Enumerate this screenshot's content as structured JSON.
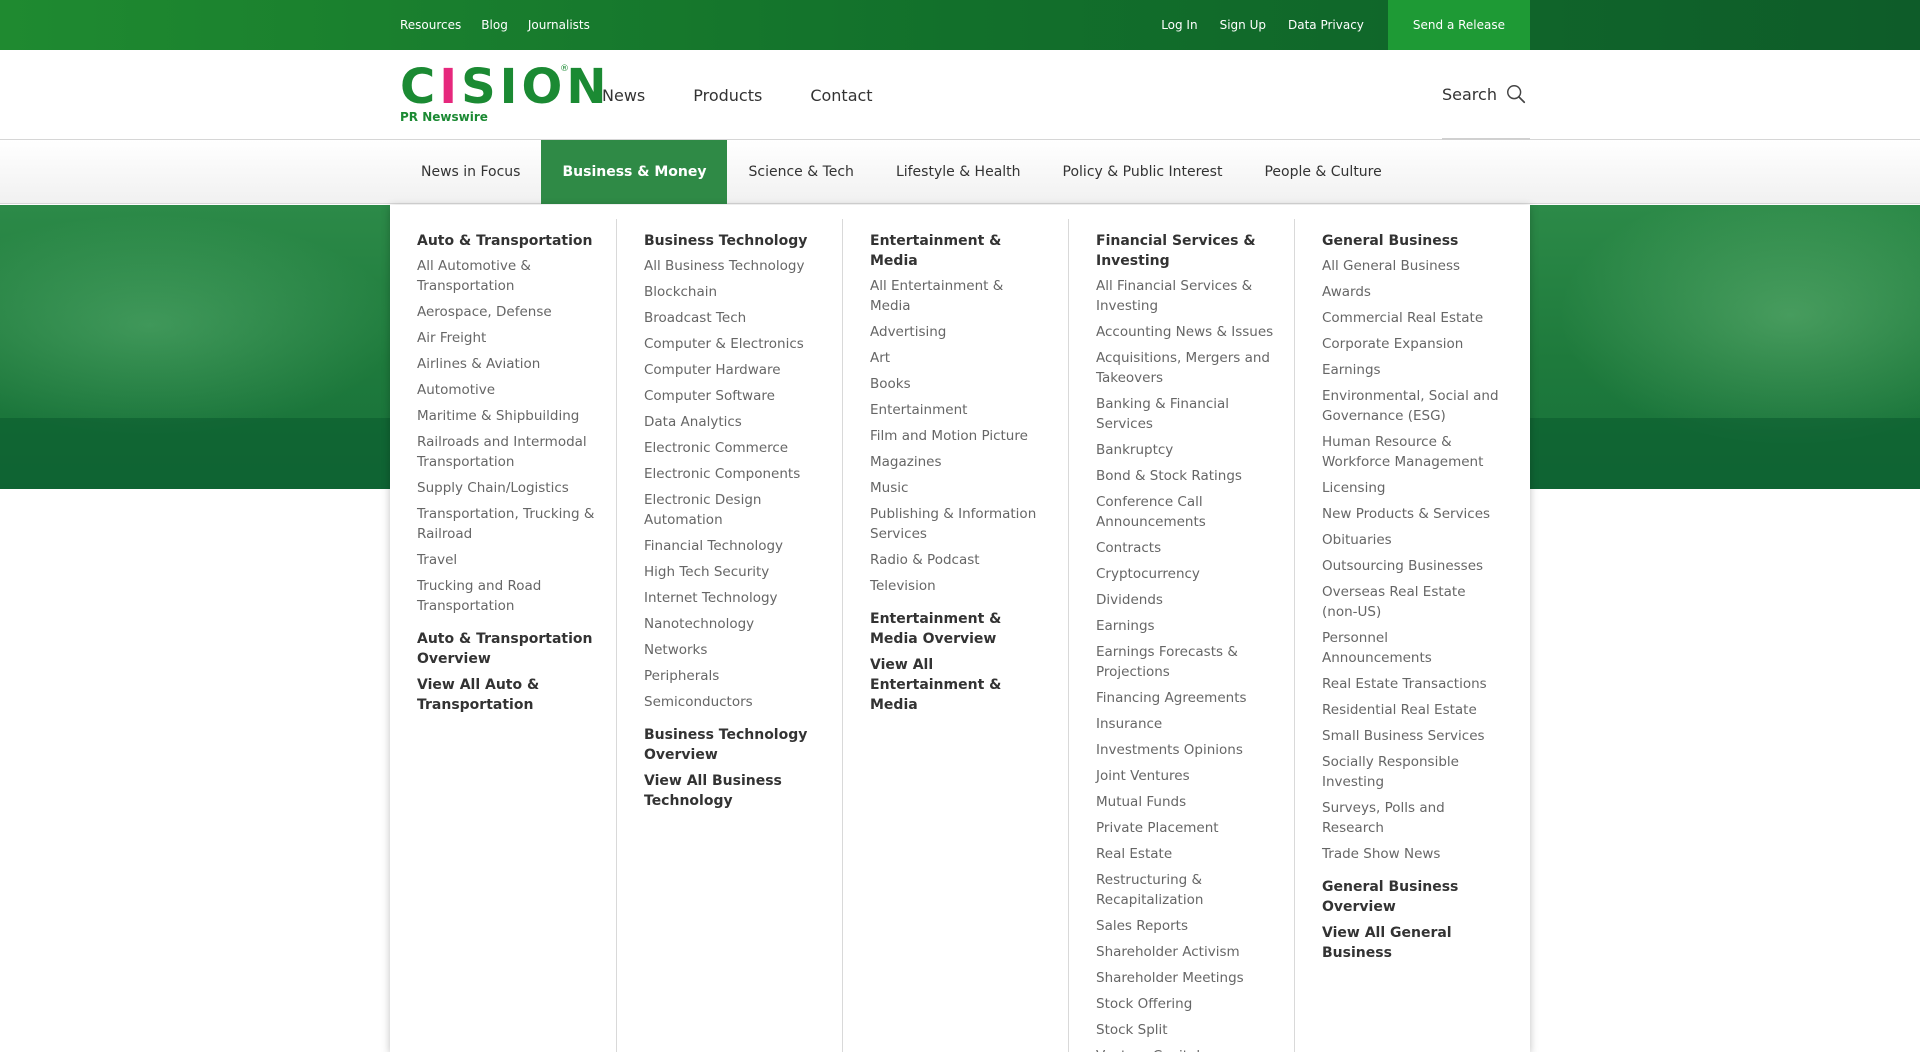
{
  "topbar": {
    "left_links": [
      "Resources",
      "Blog",
      "Journalists"
    ],
    "right_links": [
      "Log In",
      "Sign Up",
      "Data Privacy"
    ],
    "cta": "Send a Release"
  },
  "header": {
    "logo_text": "CISION",
    "logo_reg": "®",
    "logo_sub": "PR Newswire",
    "nav": [
      "News",
      "Products",
      "Contact"
    ],
    "search_label": "Search"
  },
  "categories": {
    "items": [
      "News in Focus",
      "Business & Money",
      "Science & Tech",
      "Lifestyle & Health",
      "Policy & Public Interest",
      "People & Culture"
    ],
    "active": "Business & Money"
  },
  "colors": {
    "brand_green": "#1b8a33",
    "brand_pink": "#e6287d",
    "active_tab": "#2f8a46"
  },
  "mega": {
    "columns": [
      {
        "title": "Auto & Transportation",
        "items": [
          "All Automotive & Transportation",
          "Aerospace, Defense",
          "Air Freight",
          "Airlines & Aviation",
          "Automotive",
          "Maritime & Shipbuilding",
          "Railroads and Intermodal Transportation",
          "Supply Chain/Logistics",
          "Transportation, Trucking & Railroad",
          "Travel",
          "Trucking and Road Transportation"
        ],
        "overview": "Auto & Transportation Overview",
        "view_all": "View All Auto & Transportation"
      },
      {
        "title": "Business Technology",
        "items": [
          "All Business Technology",
          "Blockchain",
          "Broadcast Tech",
          "Computer & Electronics",
          "Computer Hardware",
          "Computer Software",
          "Data Analytics",
          "Electronic Commerce",
          "Electronic Components",
          "Electronic Design Automation",
          "Financial Technology",
          "High Tech Security",
          "Internet Technology",
          "Nanotechnology",
          "Networks",
          "Peripherals",
          "Semiconductors"
        ],
        "overview": "Business Technology Overview",
        "view_all": "View All Business Technology"
      },
      {
        "title": "Entertainment & Media",
        "items": [
          "All Entertainment & Media",
          "Advertising",
          "Art",
          "Books",
          "Entertainment",
          "Film and Motion Picture",
          "Magazines",
          "Music",
          "Publishing & Information Services",
          "Radio & Podcast",
          "Television"
        ],
        "overview": "Entertainment & Media Overview",
        "view_all": "View All Entertainment & Media"
      },
      {
        "title": "Financial Services & Investing",
        "items": [
          "All Financial Services & Investing",
          "Accounting News & Issues",
          "Acquisitions, Mergers and Takeovers",
          "Banking & Financial Services",
          "Bankruptcy",
          "Bond & Stock Ratings",
          "Conference Call Announcements",
          "Contracts",
          "Cryptocurrency",
          "Dividends",
          "Earnings",
          "Earnings Forecasts & Projections",
          "Financing Agreements",
          "Insurance",
          "Investments Opinions",
          "Joint Ventures",
          "Mutual Funds",
          "Private Placement",
          "Real Estate",
          "Restructuring & Recapitalization",
          "Sales Reports",
          "Shareholder Activism",
          "Shareholder Meetings",
          "Stock Offering",
          "Stock Split",
          "Venture Capital"
        ],
        "overview": "",
        "view_all": ""
      },
      {
        "title": "General Business",
        "items": [
          "All General Business",
          "Awards",
          "Commercial Real Estate",
          "Corporate Expansion",
          "Earnings",
          "Environmental, Social and Governance (ESG)",
          "Human Resource & Workforce Management",
          "Licensing",
          "New Products & Services",
          "Obituaries",
          "Outsourcing Businesses",
          "Overseas Real Estate (non-US)",
          "Personnel Announcements",
          "Real Estate Transactions",
          "Residential Real Estate",
          "Small Business Services",
          "Socially Responsible Investing",
          "Surveys, Polls and Research",
          "Trade Show News"
        ],
        "overview": "General Business Overview",
        "view_all": "View All General Business"
      }
    ]
  }
}
